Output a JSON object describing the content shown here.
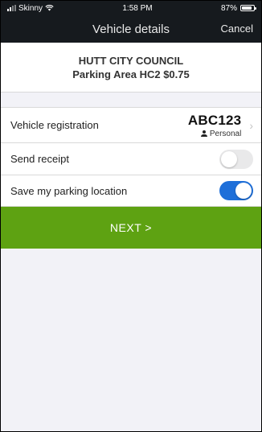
{
  "status_bar": {
    "carrier": "Skinny",
    "time": "1:58 PM",
    "battery": "87%",
    "battery_level": 0.87,
    "icons": [
      "signal-icon",
      "wifi-icon",
      "battery-icon"
    ]
  },
  "nav": {
    "title": "Vehicle details",
    "cancel_label": "Cancel"
  },
  "header": {
    "council": "HUTT CITY COUNCIL",
    "area": "Parking Area HC2 $0.75"
  },
  "vehicle": {
    "label": "Vehicle registration",
    "plate": "ABC123",
    "type": "Personal"
  },
  "receipt": {
    "label": "Send receipt",
    "enabled": false
  },
  "save_location": {
    "label": "Save my parking location",
    "enabled": true
  },
  "next_button": {
    "label": "NEXT >"
  },
  "colors": {
    "nav_background": "#161a1e",
    "accent_green": "#5ea212",
    "toggle_on": "#1e6fd9",
    "toggle_off": "#e9e9ea"
  }
}
